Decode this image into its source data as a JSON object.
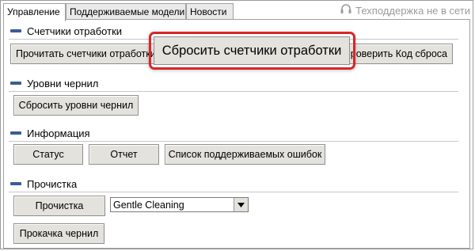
{
  "tabs": [
    {
      "label": "Управление",
      "active": true
    },
    {
      "label": "Поддерживаемые модели",
      "active": false
    },
    {
      "label": "Новости",
      "active": false
    }
  ],
  "support": {
    "label": "Техподдержка не в сети",
    "icon": "headset-icon",
    "color": "#9b9b9b"
  },
  "sections": {
    "counters": {
      "title": "Счетчики отработки",
      "read_button": "Прочитать счетчики отработки",
      "reset_button": "Сбросить счетчики отработки",
      "check_button": "Проверить Код сброса"
    },
    "ink_levels": {
      "title": "Уровни чернил",
      "reset_button": "Сбросить уровни чернил"
    },
    "information": {
      "title": "Информация",
      "status_button": "Статус",
      "report_button": "Отчет",
      "errors_button": "Список поддерживаемых ошибок"
    },
    "cleaning": {
      "title": "Прочистка",
      "clean_button": "Прочистка",
      "mode_select": {
        "value": "Gentle Cleaning"
      },
      "ink_flush_button": "Прокачка чернил"
    }
  },
  "highlight_color": "#d9262a",
  "accent_color": "#3d5a99"
}
